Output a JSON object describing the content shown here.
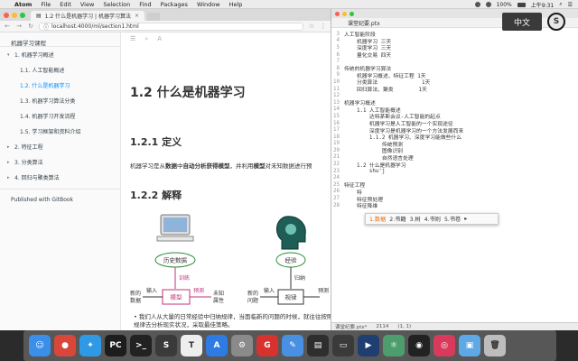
{
  "menubar": {
    "app_name": "Atom",
    "items": [
      "File",
      "Edit",
      "View",
      "Selection",
      "Find",
      "Packages",
      "Window",
      "Help"
    ],
    "battery": "100%",
    "clock": "上午9:31"
  },
  "browser": {
    "tab_title": "1.2 什么是机器学习 | 机器学习算法",
    "tab_close": "×",
    "url": "localhost:4000/ml/section1.html"
  },
  "sidebar": {
    "title": "机器学习课程",
    "items": [
      {
        "label": "1. 机器学习概述",
        "arrow": "▾"
      },
      {
        "label": "1.1. 人工智能概述"
      },
      {
        "label": "1.2. 什么是机器学习"
      },
      {
        "label": "1.3. 机器学习算法分类"
      },
      {
        "label": "1.4. 机器学习开发流程"
      },
      {
        "label": "1.5. 学习框架和资料介绍"
      },
      {
        "label": "2. 特征工程",
        "arrow": "▸"
      },
      {
        "label": "3. 分类算法",
        "arrow": "▸"
      },
      {
        "label": "4. 回归与聚类算法",
        "arrow": "▸"
      }
    ],
    "footer": "Published with GitBook"
  },
  "content": {
    "h1": "1.2 什么是机器学习",
    "h2_def": "1.2.1 定义",
    "para_1": "机器学习是从",
    "para_bold_1": "数据",
    "para_2": "中",
    "para_bold_2": "自动分析获得模型",
    "para_3": "，并利用",
    "para_bold_3": "模型",
    "para_4": "对未知数据进行预",
    "h2_exp": "1.2.2 解释",
    "bullet": "我们人从大量的日常经验中归纳规律，当面临新的问题的时候，就往往按照的规律去分析现实状况，采取最佳策略。",
    "diagram": {
      "history": "历史数据",
      "train": "训练",
      "predict": "预测",
      "new_data_1": "新的",
      "new_data_2": "数据",
      "input": "输入",
      "model": "模型",
      "unknown_1": "未知",
      "unknown_2": "属性",
      "experience": "经验",
      "induce": "归纳",
      "new_problem_1": "新的",
      "new_problem_2": "问题",
      "input2": "输入",
      "rule": "规律",
      "pred_2": "预测"
    }
  },
  "editor": {
    "tab": "课堂纪要.ptx",
    "lines": [
      {
        "n": "3",
        "t": "人工智能阶段"
      },
      {
        "n": "4",
        "t": "    机器学习 三天"
      },
      {
        "n": "5",
        "t": "    深度学习 三天"
      },
      {
        "n": "6",
        "t": "    量化交易 四天"
      },
      {
        "n": "7",
        "t": ""
      },
      {
        "n": "8",
        "t": "传统的机器学习算法"
      },
      {
        "n": "9",
        "t": "    机器学习概述、特征工程 1天"
      },
      {
        "n": "10",
        "t": "    分类算法              1天"
      },
      {
        "n": "11",
        "t": "    回归算法、聚类        1天"
      },
      {
        "n": "12",
        "t": ""
      },
      {
        "n": "13",
        "t": "机器学习概述"
      },
      {
        "n": "14",
        "t": "    1.1 人工智能概述"
      },
      {
        "n": "15",
        "t": "        达特茅斯会议-人工智能的起点"
      },
      {
        "n": "16",
        "t": "        机器学习是人工智能的一个实现途径"
      },
      {
        "n": "17",
        "t": "        深度学习是机器学习的一个方法发展而来"
      },
      {
        "n": "18",
        "t": "        1.1.2 机器学习、深度学习能做些什么"
      },
      {
        "n": "19",
        "t": "            传统预测"
      },
      {
        "n": "20",
        "t": "            图像识别"
      },
      {
        "n": "21",
        "t": "            自然语言处理"
      },
      {
        "n": "22",
        "t": "    1.2 什么是机器学习"
      },
      {
        "n": "23",
        "t": "        shu'j"
      },
      {
        "n": "24",
        "t": ""
      },
      {
        "n": "25",
        "t": "特征工程"
      },
      {
        "n": "26",
        "t": "    特"
      },
      {
        "n": "27",
        "t": "    特征预处理"
      },
      {
        "n": "28",
        "t": "    特征降维"
      }
    ],
    "status_file": "课堂纪要.ptx*",
    "status_chars": "2114",
    "status_pos": "(1, 1)"
  },
  "ime": {
    "badge": "中文",
    "logo": "S",
    "candidates": [
      "1.数据",
      "2.书籍",
      "3.树",
      "4.书则",
      "5.书卷"
    ],
    "arrow": "▸"
  },
  "dock": {
    "apps": [
      {
        "name": "finder",
        "label": "☺",
        "color": "#3b8fe8"
      },
      {
        "name": "chrome",
        "label": "●",
        "color": "#d9473b"
      },
      {
        "name": "safari",
        "label": "✦",
        "color": "#2e9ae6"
      },
      {
        "name": "pycharm",
        "label": "PC",
        "color": "#1d1d1d"
      },
      {
        "name": "terminal",
        "label": ">_",
        "color": "#222222"
      },
      {
        "name": "sublime",
        "label": "S",
        "color": "#3a3a3a"
      },
      {
        "name": "typora",
        "label": "T",
        "color": "#eeeeee"
      },
      {
        "name": "appstore",
        "label": "A",
        "color": "#2d7be3"
      },
      {
        "name": "system-prefs",
        "label": "⚙",
        "color": "#8a8a8a"
      },
      {
        "name": "gitkraken",
        "label": "G",
        "color": "#d8322e"
      },
      {
        "name": "editor",
        "label": "✎",
        "color": "#4a90e2"
      },
      {
        "name": "activity",
        "label": "▤",
        "color": "#2e2e2e"
      },
      {
        "name": "keynote",
        "label": "▭",
        "color": "#3a3a3a"
      },
      {
        "name": "quicktime",
        "label": "▶",
        "color": "#1f3f72"
      },
      {
        "name": "atom",
        "label": "⚛",
        "color": "#4e9d6e"
      },
      {
        "name": "obs",
        "label": "◉",
        "color": "#222222"
      },
      {
        "name": "lips",
        "label": "◎",
        "color": "#d93a5c"
      },
      {
        "name": "folder",
        "label": "▣",
        "color": "#5fa8e6"
      },
      {
        "name": "trash",
        "label": "🗑",
        "color": "#bdbdbd"
      }
    ]
  }
}
